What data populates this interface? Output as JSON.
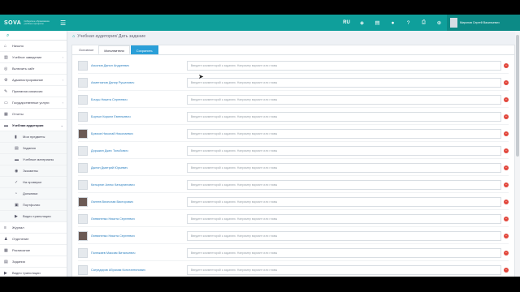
{
  "brand": {
    "name": "SOVA",
    "tagline": "Сибирское образование учебные процессы"
  },
  "topbar": {
    "lang": "RU",
    "user_name": "Миронов Сергей Васильевич",
    "icons": [
      "layers-icon",
      "clipboard-icon",
      "user-icon",
      "help-icon",
      "print-icon",
      "support-icon"
    ]
  },
  "sidebar": {
    "search_icon": "search-icon",
    "items": [
      {
        "label": "Начало",
        "icon": "home-icon"
      },
      {
        "label": "Учебное заведение",
        "icon": "building-icon",
        "chev": "‹"
      },
      {
        "label": "Включить сайт",
        "icon": "globe-icon"
      },
      {
        "label": "Администрирование",
        "icon": "gear-icon",
        "chev": "‹"
      },
      {
        "label": "Приемная комиссия",
        "icon": "pen-icon"
      },
      {
        "label": "Государственные услуги",
        "icon": "doc-icon",
        "chev": "‹"
      },
      {
        "label": "Отчеты",
        "icon": "chart-icon"
      },
      {
        "label": "Учебная аудитория",
        "icon": "class-icon",
        "chev": "⌄"
      }
    ],
    "subitems": [
      {
        "label": "Мои предметы",
        "icon": "book-icon"
      },
      {
        "label": "Задания",
        "icon": "tasks-icon"
      },
      {
        "label": "Учебные материалы",
        "icon": "folder-icon"
      },
      {
        "label": "Экзамены",
        "icon": "exam-icon"
      },
      {
        "label": "На проверке",
        "icon": "check-icon"
      },
      {
        "label": "Должники",
        "icon": "debt-icon"
      },
      {
        "label": "Портфолио",
        "icon": "portfolio-icon"
      },
      {
        "label": "Видео трансляции",
        "icon": "video-icon"
      }
    ],
    "items2": [
      {
        "label": "Журнал",
        "icon": "journal-icon"
      },
      {
        "label": "Отделение",
        "icon": "org-icon"
      },
      {
        "label": "Расписание",
        "icon": "calendar-icon"
      },
      {
        "label": "Задания",
        "icon": "tasks2-icon"
      },
      {
        "label": "Видео трансляции",
        "icon": "video2-icon"
      }
    ]
  },
  "breadcrumb": "Учебная аудитория/ Дать задание",
  "tabs": [
    {
      "label": "Основное",
      "state": "normal"
    },
    {
      "label": "Исполнители",
      "state": "active"
    },
    {
      "label": "Сохранить",
      "state": "save"
    }
  ],
  "placeholder": "Введите комментарий к заданию. Например вариант или главы",
  "students": [
    {
      "name": "Ахьянов Данил Андреевич",
      "photo": false
    },
    {
      "name": "Ахметзянов Данир Рушатович",
      "photo": false
    },
    {
      "name": "Бочуш Никита Сергеевич",
      "photo": false
    },
    {
      "name": "Бортын Кирилл Евгеньевич",
      "photo": false
    },
    {
      "name": "Брюхов Николай Николаевич",
      "photo": true
    },
    {
      "name": "Доршкин Джес Тольбович",
      "photo": false
    },
    {
      "name": "Дынин Дмитрий Юрьевич",
      "photo": false
    },
    {
      "name": "Катыргин Алекс Катыргинович",
      "photo": false
    },
    {
      "name": "Лаптев Вячеслав Викторович",
      "photo": true
    },
    {
      "name": "Латвиненко Никита Сергеевич",
      "photo": false
    },
    {
      "name": "Латвиненко Никита Сергеевич",
      "photo": true
    },
    {
      "name": "Полежаев Максим Витальевич",
      "photo": false
    },
    {
      "name": "Сагундаров Абрахам Константинович",
      "photo": false
    }
  ],
  "colors": {
    "accent": "#0f9f9b",
    "save": "#2a9fd8",
    "delete": "#e2483d"
  }
}
